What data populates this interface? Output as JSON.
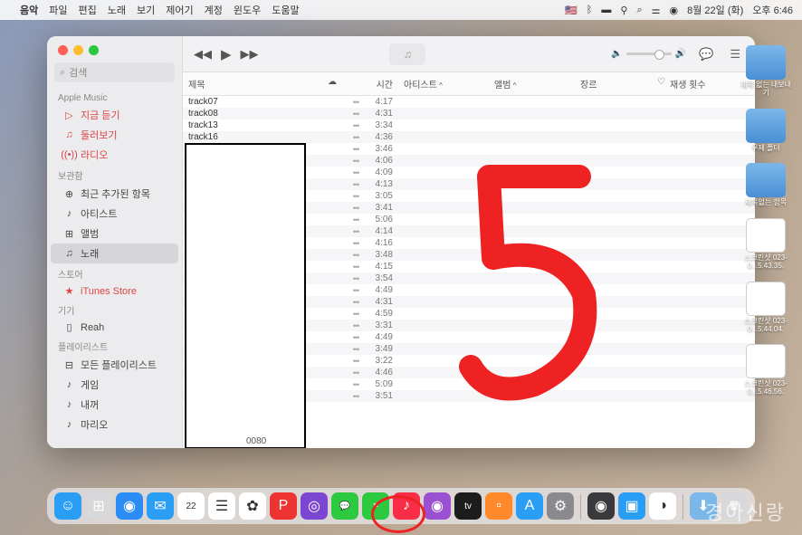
{
  "menubar": {
    "app": "음악",
    "items": [
      "파일",
      "편집",
      "노래",
      "보기",
      "제어기",
      "계정",
      "윈도우",
      "도움말"
    ],
    "right": {
      "flag": "🇺🇸",
      "date": "8월 22일 (화)",
      "time": "오후 6:46"
    }
  },
  "sidebar": {
    "search_placeholder": "검색",
    "sections": [
      {
        "title": "Apple Music",
        "items": [
          {
            "icon": "▷",
            "label": "지금 듣기",
            "accent": true
          },
          {
            "icon": "♫",
            "label": "둘러보기",
            "accent": true
          },
          {
            "icon": "((•))",
            "label": "라디오",
            "accent": true
          }
        ]
      },
      {
        "title": "보관함",
        "items": [
          {
            "icon": "⊕",
            "label": "최근 추가된 항목"
          },
          {
            "icon": "♪",
            "label": "아티스트"
          },
          {
            "icon": "⊞",
            "label": "앨범"
          },
          {
            "icon": "♫",
            "label": "노래",
            "selected": true
          }
        ]
      },
      {
        "title": "스토어",
        "items": [
          {
            "icon": "★",
            "label": "iTunes Store",
            "accent": true
          }
        ]
      },
      {
        "title": "기기",
        "items": [
          {
            "icon": "▯",
            "label": "Reah"
          }
        ]
      },
      {
        "title": "플레이리스트",
        "items": [
          {
            "icon": "⊟",
            "label": "모든 플레이리스트"
          },
          {
            "icon": "♪",
            "label": "게임"
          },
          {
            "icon": "♪",
            "label": "내꺼"
          },
          {
            "icon": "♪",
            "label": "마리오"
          }
        ]
      }
    ]
  },
  "columns": {
    "title": "제목",
    "cloud": "☁",
    "time": "시간",
    "artist": "아티스트",
    "album": "앨범",
    "genre": "장르",
    "plays": "재생 횟수"
  },
  "tracks": [
    {
      "title": "track07",
      "time": "4:17"
    },
    {
      "title": "track08",
      "time": "4:31"
    },
    {
      "title": "track13",
      "time": "3:34"
    },
    {
      "title": "track16",
      "time": "4:36"
    },
    {
      "title": "",
      "time": "3:46"
    },
    {
      "title": "",
      "time": "4:06"
    },
    {
      "title": "",
      "time": "4:09"
    },
    {
      "title": "",
      "time": "4:13"
    },
    {
      "title": "",
      "time": "3:05"
    },
    {
      "title": "",
      "time": "3:41"
    },
    {
      "title": "",
      "time": "5:06"
    },
    {
      "title": "",
      "time": "4:14"
    },
    {
      "title": "",
      "time": "4:16"
    },
    {
      "title": "",
      "time": "3:48"
    },
    {
      "title": "",
      "time": "4:15"
    },
    {
      "title": "",
      "time": "3:54"
    },
    {
      "title": "",
      "time": "4:49"
    },
    {
      "title": "",
      "time": "4:31"
    },
    {
      "title": "",
      "time": "4:59"
    },
    {
      "title": "",
      "time": "3:31"
    },
    {
      "title": "",
      "time": "4:49"
    },
    {
      "title": "",
      "time": "3:49"
    },
    {
      "title": "",
      "time": "3:22"
    },
    {
      "title": "",
      "time": "4:46"
    },
    {
      "title": "",
      "time": "5:09"
    },
    {
      "title": "",
      "time": "3:51"
    }
  ],
  "bottom_label": "0080",
  "desktop_icons": [
    {
      "type": "folder",
      "label": "제목 없는 내보내기"
    },
    {
      "type": "folder",
      "label": "무제 폴더"
    },
    {
      "type": "folder",
      "label": "제목없는 함목"
    },
    {
      "type": "file",
      "label": "스크린샷\n023-0...5.43.35."
    },
    {
      "type": "file",
      "label": "스크린샷\n023-0...5.44.04."
    },
    {
      "type": "file",
      "label": "스크린샷\n023-0...5.46.56."
    }
  ],
  "dock": [
    {
      "name": "finder",
      "color": "#2a9df4",
      "glyph": "☺"
    },
    {
      "name": "launchpad",
      "color": "#d8d8db",
      "glyph": "⊞"
    },
    {
      "name": "safari",
      "color": "#2a8cf4",
      "glyph": "◉"
    },
    {
      "name": "mail",
      "color": "#2a9df4",
      "glyph": "✉"
    },
    {
      "name": "calendar",
      "color": "#fff",
      "glyph": "22"
    },
    {
      "name": "reminders",
      "color": "#fff",
      "glyph": "☰"
    },
    {
      "name": "photos",
      "color": "#fff",
      "glyph": "✿"
    },
    {
      "name": "app1",
      "color": "#e33",
      "glyph": "P"
    },
    {
      "name": "app2",
      "color": "#7b46d1",
      "glyph": "◎"
    },
    {
      "name": "messages",
      "color": "#2cc941",
      "glyph": "💬"
    },
    {
      "name": "facetime",
      "color": "#2cc941",
      "glyph": "▪"
    },
    {
      "name": "music",
      "color": "#fa2d48",
      "glyph": "♪"
    },
    {
      "name": "podcasts",
      "color": "#9b4fd1",
      "glyph": "◉"
    },
    {
      "name": "tv",
      "color": "#1c1c1c",
      "glyph": "tv"
    },
    {
      "name": "books",
      "color": "#ff8a2c",
      "glyph": "▫"
    },
    {
      "name": "appstore",
      "color": "#2a9df4",
      "glyph": "A"
    },
    {
      "name": "settings",
      "color": "#8a8a8e",
      "glyph": "⚙"
    },
    {
      "name": "sep",
      "sep": true
    },
    {
      "name": "app3",
      "color": "#3a3a3c",
      "glyph": "◉"
    },
    {
      "name": "app4",
      "color": "#2a9df4",
      "glyph": "▣"
    },
    {
      "name": "app5",
      "color": "#fff",
      "glyph": "◑"
    },
    {
      "name": "sep2",
      "sep": true
    },
    {
      "name": "downloads",
      "color": "#7bb7e8",
      "glyph": "⬇"
    },
    {
      "name": "trash",
      "color": "#d8d8db",
      "glyph": "🗑"
    }
  ],
  "watermark": "경아신랑"
}
